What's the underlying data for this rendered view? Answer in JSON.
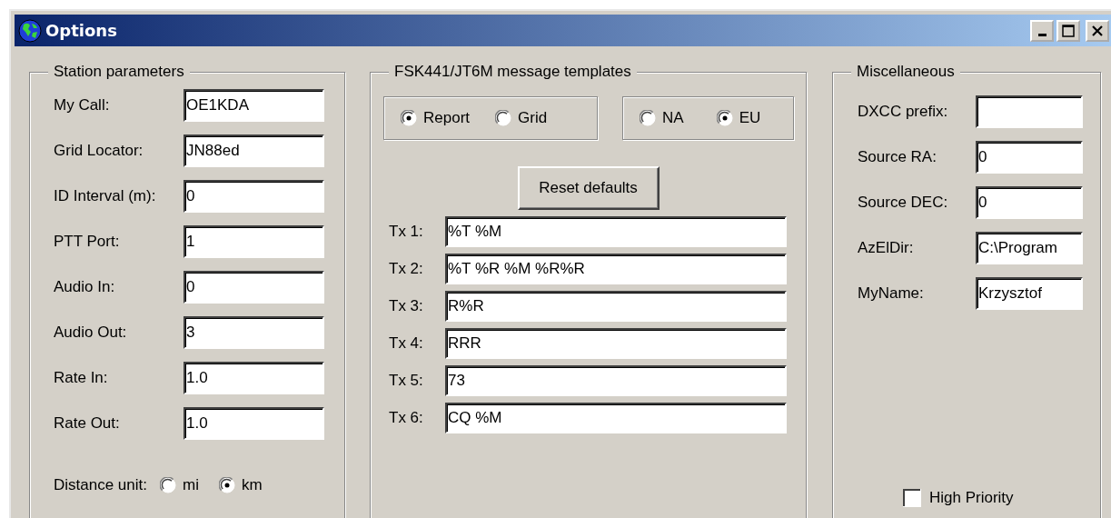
{
  "window": {
    "title": "Options"
  },
  "station_parameters": {
    "title": "Station parameters",
    "fields": [
      {
        "label": "My Call:",
        "value": "OE1KDA"
      },
      {
        "label": "Grid Locator:",
        "value": "JN88ed"
      },
      {
        "label": "ID Interval (m):",
        "value": "0"
      },
      {
        "label": "PTT Port:",
        "value": "1"
      },
      {
        "label": "Audio In:",
        "value": "0"
      },
      {
        "label": "Audio Out:",
        "value": "3"
      },
      {
        "label": "Rate In:",
        "value": "1.0"
      },
      {
        "label": "Rate Out:",
        "value": "1.0"
      }
    ],
    "distance_unit": {
      "label": "Distance unit:",
      "options": [
        {
          "label": "mi",
          "selected": false
        },
        {
          "label": "km",
          "selected": true
        }
      ]
    }
  },
  "message_templates": {
    "title": "FSK441/JT6M message templates",
    "message_type": [
      {
        "label": "Report",
        "selected": true
      },
      {
        "label": "Grid",
        "selected": false
      }
    ],
    "region": [
      {
        "label": "NA",
        "selected": false
      },
      {
        "label": "EU",
        "selected": true
      }
    ],
    "reset_button": "Reset defaults",
    "templates": [
      {
        "label": "Tx 1:",
        "value": "%T %M"
      },
      {
        "label": "Tx 2:",
        "value": "%T %R %M %R%R"
      },
      {
        "label": "Tx 3:",
        "value": "R%R"
      },
      {
        "label": "Tx 4:",
        "value": "RRR"
      },
      {
        "label": "Tx 5:",
        "value": "73"
      },
      {
        "label": "Tx 6:",
        "value": "CQ %M"
      }
    ]
  },
  "miscellaneous": {
    "title": "Miscellaneous",
    "fields": [
      {
        "label": "DXCC prefix:"
      },
      {
        "label": "Source RA:",
        "value": "0"
      },
      {
        "label": "Source DEC:",
        "value": "0"
      },
      {
        "label": "AzElDir:",
        "value": "C:\\Program"
      },
      {
        "label": "MyName:",
        "value": "Krzysztof"
      }
    ],
    "high_priority": {
      "label": "High Priority",
      "checked": false
    }
  }
}
